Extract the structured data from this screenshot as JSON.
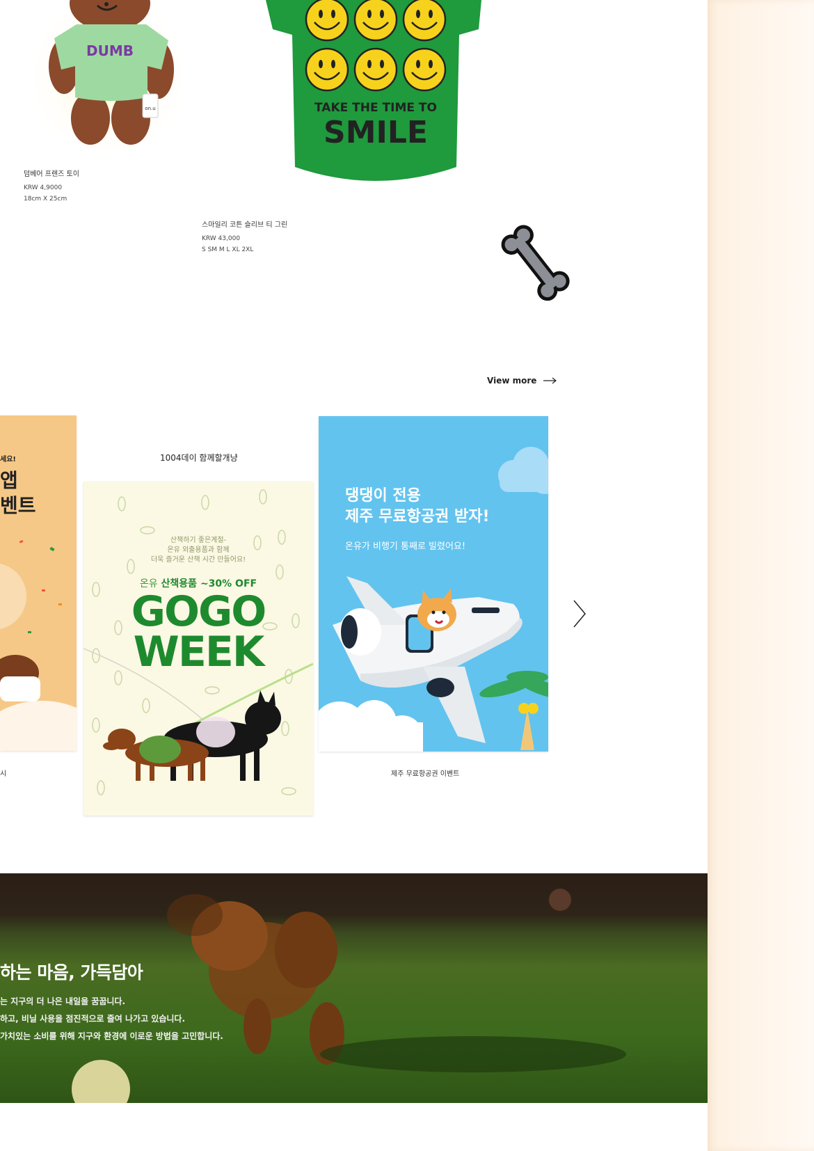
{
  "products": [
    {
      "name": "덤베어 프렌즈 토이",
      "price": "KRW 4,9000",
      "size": "18cm X 25cm",
      "shirt_text": "DUMB",
      "tag_text": "on.u"
    },
    {
      "name": "스마일리 코튼 슬리브 티 그린",
      "price": "KRW 43,000",
      "sizes": "S SM M L XL 2XL",
      "print_line1": "TAKE THE TIME TO",
      "print_line2": "SMILE"
    }
  ],
  "view_more": {
    "label": "View more"
  },
  "events": {
    "left_card": {
      "line1": "세요!",
      "line2": "앱",
      "line3": "벤트",
      "caption": "시"
    },
    "gogo_card": {
      "title": "1004데이 함께할개냥",
      "sub_line1": "산책하기 좋은계절-",
      "sub_line2": "온유 외출용품과 함께",
      "sub_line3": "더욱 즐거운 산책 시간 만들어요!",
      "promo_prefix": "온유",
      "promo_highlight": "산책용품 ~30% OFF",
      "headline1": "GOGO",
      "headline2": "WEEK"
    },
    "jeju_card": {
      "headline1": "댕댕이 전용",
      "headline2": "제주 무료항공권 받자!",
      "sub": "온유가 비행기 통째로 빌렸어요!",
      "caption": "제주 무료항공권 이벤트"
    }
  },
  "banner": {
    "title": "하는 마음, 가득담아",
    "lines": [
      "는 지구의 더 나은 내일을 꿈꿉니다.",
      "하고, 비닐 사용을 점진적으로 줄여 나가고 있습니다.",
      "가치있는 소비를 위해 지구와 환경에 이로운 방법을 고민합니다."
    ]
  },
  "colors": {
    "tee_green": "#1f9a3d",
    "gogo_green": "#1e8a2e",
    "jeju_blue": "#62c3ef",
    "side_panel": "#fdf1e2",
    "left_card_orange": "#f6c887"
  },
  "icons": [
    "bone-icon",
    "arrow-right-icon",
    "chevron-right-icon"
  ]
}
